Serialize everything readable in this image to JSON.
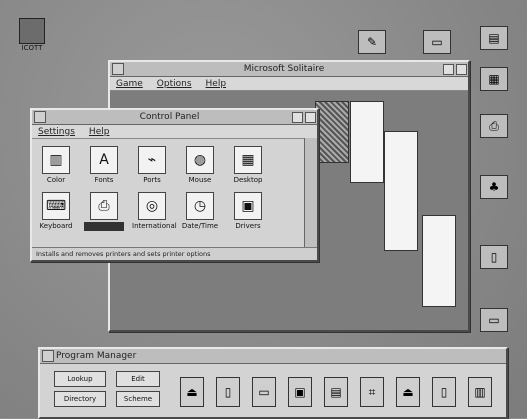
{
  "desktop": {
    "top_left_icon_label": "ICOTT",
    "top_left_icon": "program-icon",
    "right_icons": [
      "paint-icon",
      "folder-icon",
      "notepad-icon",
      "calculator-icon",
      "printer-icon",
      "card-icon",
      "file-icon",
      "window-icon"
    ]
  },
  "solitaire": {
    "title": "Microsoft Solitaire",
    "menu": [
      "Game",
      "Options",
      "Help"
    ]
  },
  "control_panel": {
    "title": "Control Panel",
    "menu": [
      "Settings",
      "Help"
    ],
    "items": [
      {
        "label": "Color",
        "icon": "color-icon"
      },
      {
        "label": "Fonts",
        "icon": "fonts-icon"
      },
      {
        "label": "Ports",
        "icon": "ports-icon"
      },
      {
        "label": "Mouse",
        "icon": "mouse-icon"
      },
      {
        "label": "Desktop",
        "icon": "desktop-icon"
      },
      {
        "label": "Keyboard",
        "icon": "keyboard-icon"
      },
      {
        "label": "",
        "icon": "printers-icon"
      },
      {
        "label": "International",
        "icon": "international-icon"
      },
      {
        "label": "Date/Time",
        "icon": "datetime-icon"
      },
      {
        "label": "Drivers",
        "icon": "drivers-icon"
      }
    ],
    "status": "Installs and removes printers and sets printer options"
  },
  "program_manager": {
    "title": "Program Manager",
    "buttons": [
      "Lookup",
      "Edit",
      "Directory",
      "Scheme"
    ]
  }
}
